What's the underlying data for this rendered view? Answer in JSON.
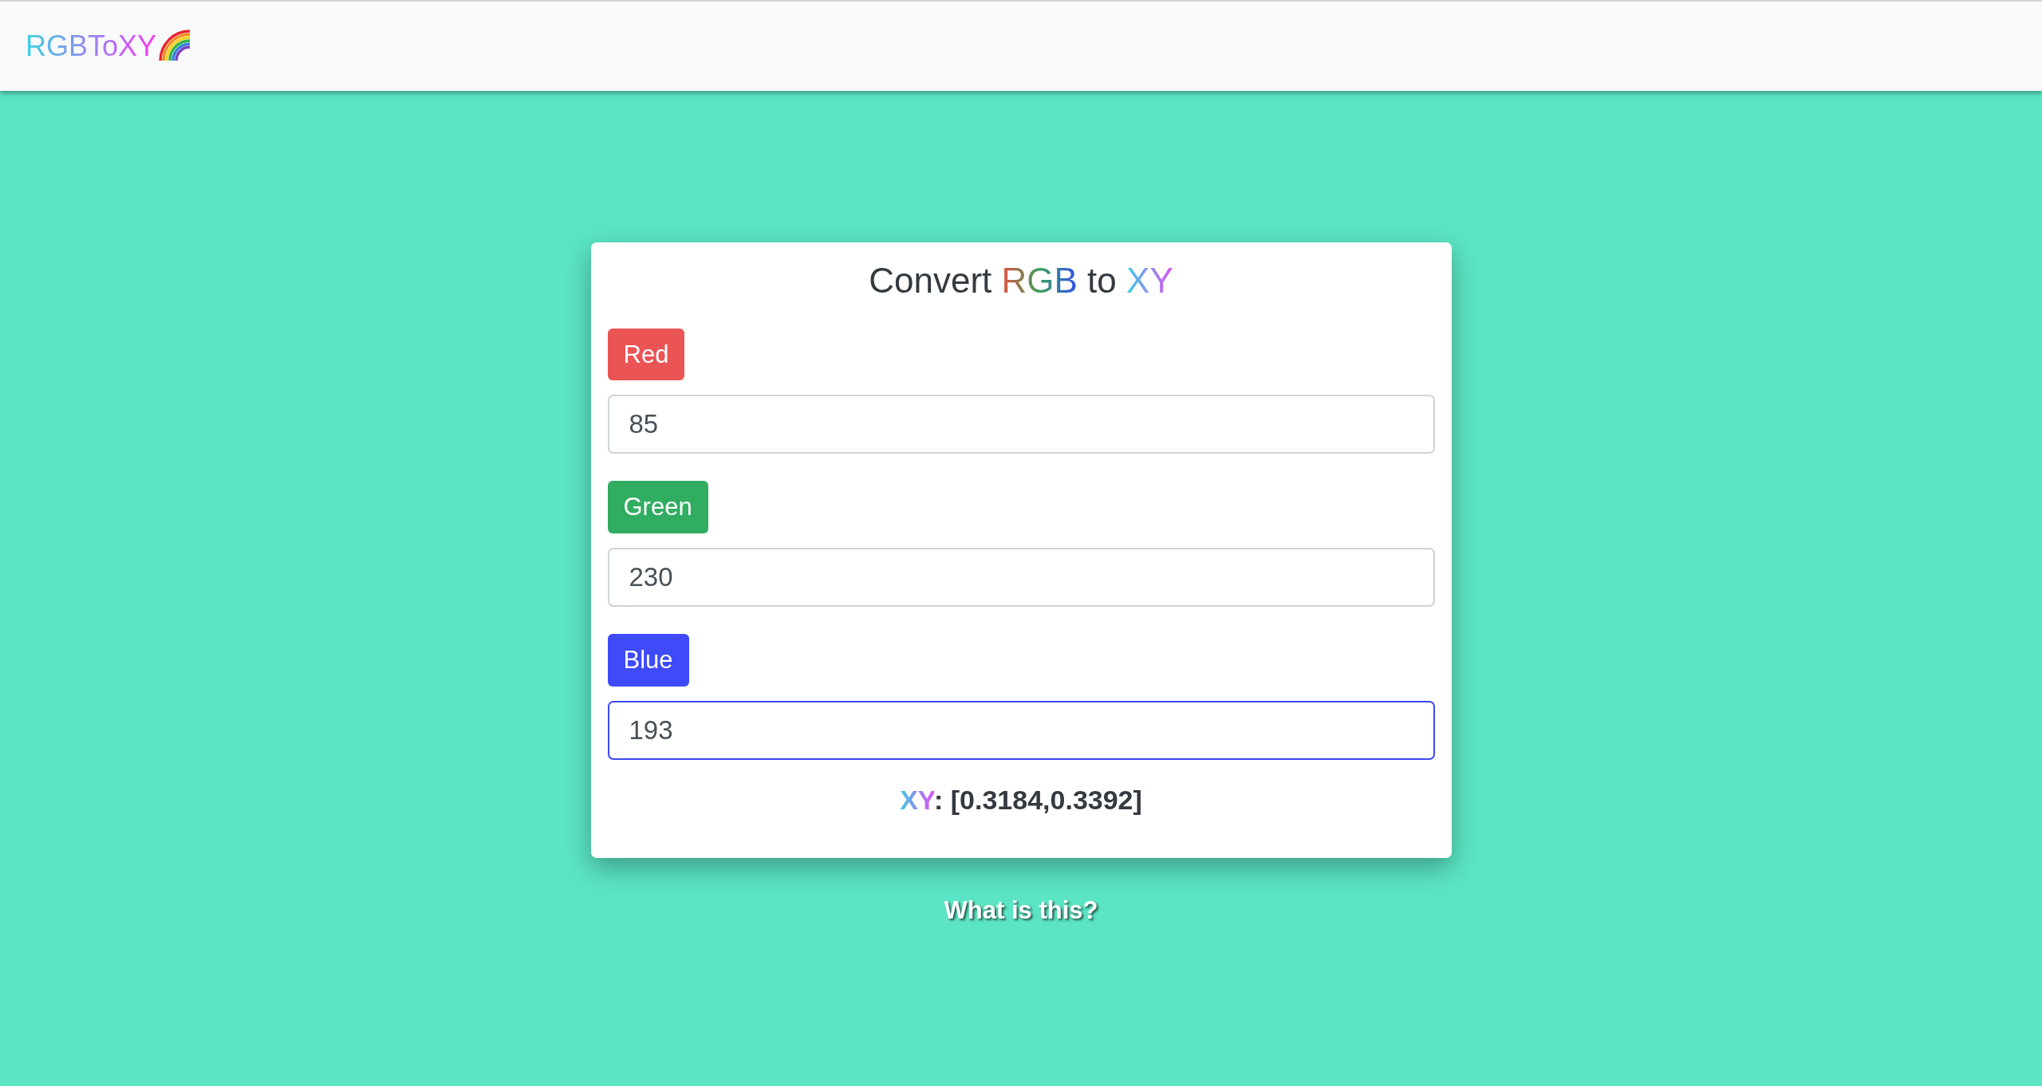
{
  "navbar": {
    "logo": "RGBToXY"
  },
  "card": {
    "title": [
      {
        "text": "Convert ",
        "kind": "plain"
      },
      {
        "text": "RGB",
        "kind": "rgb"
      },
      {
        "text": " to ",
        "kind": "plain"
      },
      {
        "text": "XY",
        "kind": "xy"
      }
    ],
    "fields": [
      {
        "label": "Red",
        "color": "#ea5455",
        "value": "85",
        "focused": false
      },
      {
        "label": "Green",
        "color": "#31ad62",
        "value": "230",
        "focused": false
      },
      {
        "label": "Blue",
        "color": "#3f4bf9",
        "value": "193",
        "focused": true
      }
    ],
    "result": {
      "label": "XY",
      "value": ": [0.3184,0.3392]"
    }
  },
  "help_link": "What is this?"
}
